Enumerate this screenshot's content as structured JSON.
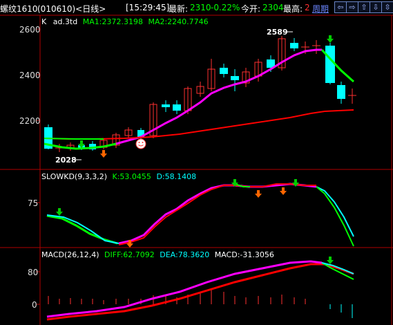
{
  "header": {
    "symbol": "螺纹1610",
    "code_period": "(010610)<日线>",
    "time": "[15:29:45]",
    "latest_label": "最新:",
    "latest_value": "2310",
    "change_pct": "-0.22%",
    "open_label": "今开:",
    "open_value": "2304",
    "high_label": "最高:",
    "high_value": "2",
    "period_link": "周期",
    "nav_buttons": [
      "⇦",
      "⇨",
      "⇧",
      "⇩",
      "⇳"
    ]
  },
  "panes": {
    "price": {
      "legend": {
        "k": "K",
        "indicator": "ad.3td",
        "ma1": "MA1:2372.3198",
        "ma2": "MA2:2240.7746"
      },
      "y_ticks": [
        "2600",
        "2400",
        "2200"
      ],
      "annotations": {
        "high": "2589",
        "low": "2028"
      }
    },
    "kd": {
      "legend": {
        "name": "SLOWKD(9,3,3,2)",
        "k": "K:53.0455",
        "d": "D:58.1408"
      },
      "y_ticks": [
        "75"
      ]
    },
    "macd": {
      "legend": {
        "name": "MACD(26,12,4)",
        "diff": "DIFF:62.7092",
        "dea": "DEA:78.3620",
        "macd": "MACD:-31.3056"
      },
      "y_ticks": [
        "80",
        "0"
      ]
    }
  },
  "colors": {
    "bg": "#000000",
    "up": "#ff3030",
    "down": "#00ffff",
    "ma1": "#ff00ff",
    "ma2": "#ff0000",
    "green": "#00ff00",
    "grid_red": "#b00000",
    "axis_text": "#dddddd",
    "legend_green": "#00ff00",
    "legend_yellow": "#ffff00",
    "legend_cyan": "#00ffff",
    "legend_magenta": "#ff00ff"
  }
}
